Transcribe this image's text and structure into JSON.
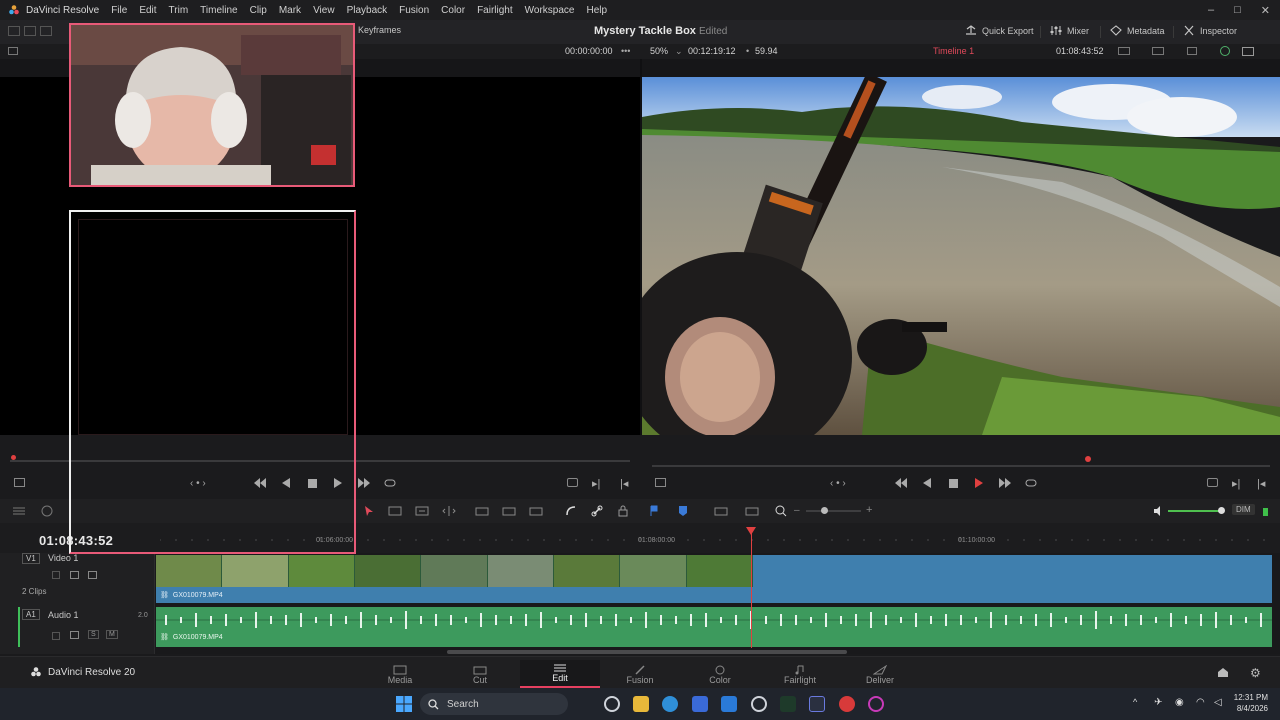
{
  "app": {
    "name": "DaVinci Resolve",
    "menu": [
      "File",
      "Edit",
      "Trim",
      "Timeline",
      "Clip",
      "Mark",
      "View",
      "Playback",
      "Fusion",
      "Color",
      "Fairlight",
      "Workspace",
      "Help"
    ]
  },
  "toolbar": {
    "keyframes_label": "Keyframes",
    "project_title": "Mystery Tackle Box",
    "project_status": "Edited",
    "quick_export": "Quick Export",
    "mixer": "Mixer",
    "metadata": "Metadata",
    "inspector": "Inspector"
  },
  "viewer": {
    "source_timecode": "00:00:00:00",
    "zoom": "50%",
    "duration": "00:12:19:12",
    "fps": "59.94",
    "timeline_name": "Timeline 1",
    "program_timecode": "01:08:43:52",
    "dim_label": "DIM"
  },
  "timeline": {
    "current_timecode": "01:08:43:52",
    "ruler_labels": [
      "01:06:00:00",
      "01:08:00:00",
      "01:10:00:00"
    ],
    "video_track": {
      "id": "V1",
      "name": "Video 1",
      "clip_count": "2 Clips",
      "clip_name": "GX010079.MP4"
    },
    "audio_track": {
      "id": "A1",
      "name": "Audio 1",
      "channels": "2.0",
      "clip_name": "GX010079.MP4"
    }
  },
  "pages": {
    "brand": "DaVinci Resolve 20",
    "tabs": [
      "Media",
      "Cut",
      "Edit",
      "Fusion",
      "Color",
      "Fairlight",
      "Deliver"
    ],
    "active": "Edit"
  },
  "taskbar": {
    "search_placeholder": "Search",
    "time": "12:31 PM",
    "date": "8/4/2026"
  },
  "colors": {
    "accent": "#e64060",
    "video_clip": "#3f7fae",
    "audio_clip": "#3d9a5d",
    "playhead": "#e04040"
  }
}
